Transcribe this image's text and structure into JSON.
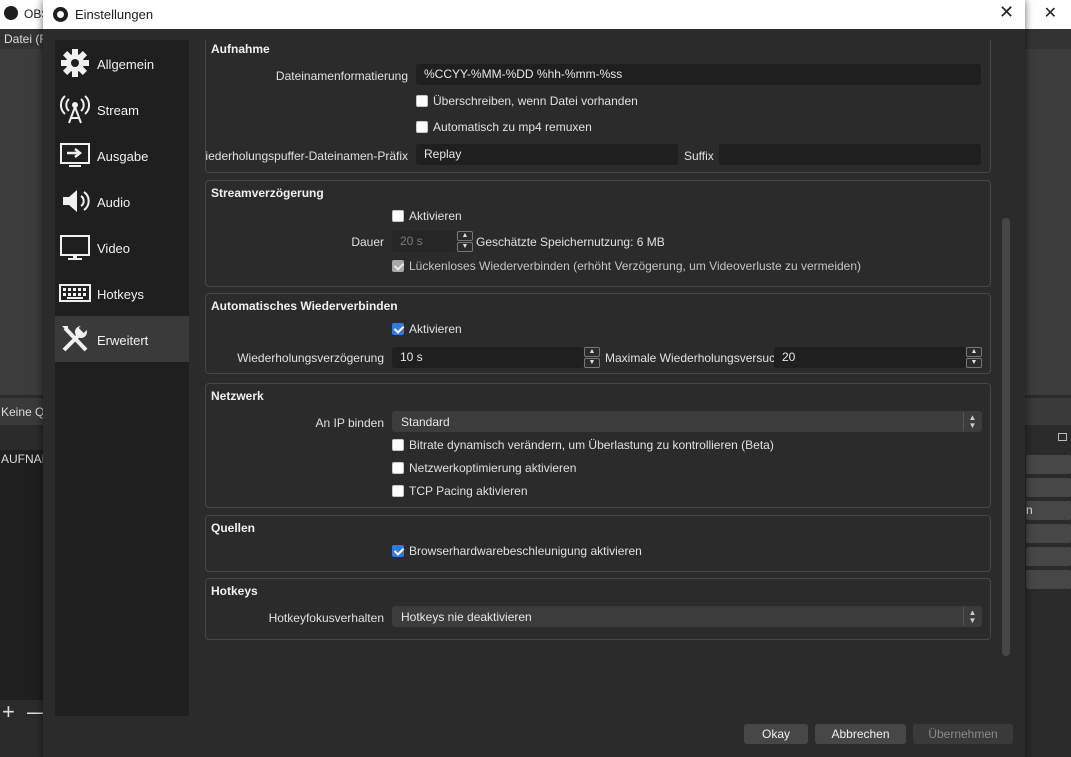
{
  "background": {
    "title": "OBS",
    "menu_label": "Datei (F",
    "dock_label": "Keine Qu",
    "list_item": "AUFNAH",
    "right_text": "n",
    "add_symbol": "+",
    "remove_symbol": "—"
  },
  "dialog": {
    "title": "Einstellungen",
    "close": "✕"
  },
  "sidebar": {
    "items": [
      {
        "label": "Allgemein",
        "icon": "gear-icon"
      },
      {
        "label": "Stream",
        "icon": "broadcast-icon"
      },
      {
        "label": "Ausgabe",
        "icon": "output-icon"
      },
      {
        "label": "Audio",
        "icon": "speaker-icon"
      },
      {
        "label": "Video",
        "icon": "monitor-icon"
      },
      {
        "label": "Hotkeys",
        "icon": "keyboard-icon"
      },
      {
        "label": "Erweitert",
        "icon": "tools-icon"
      }
    ],
    "active_index": 6
  },
  "aufnahme": {
    "title": "Aufnahme",
    "filename_label": "Dateinamenformatierung",
    "filename_value": "%CCYY-%MM-%DD %hh-%mm-%ss",
    "overwrite_label": "Überschreiben, wenn Datei vorhanden",
    "overwrite_checked": false,
    "remux_label": "Automatisch zu mp4 remuxen",
    "remux_checked": false,
    "replay_prefix_label": "Wiederholungspuffer-Dateinamen-Präfix",
    "replay_prefix_value": "Replay",
    "suffix_label": "Suffix",
    "suffix_value": ""
  },
  "streamdelay": {
    "title": "Streamverzögerung",
    "enable_label": "Aktivieren",
    "enable_checked": false,
    "duration_label": "Dauer",
    "duration_value": "20 s",
    "memory_text": "Geschätzte Speichernutzung: 6 MB",
    "preserve_label": "Lückenloses Wiederverbinden (erhöht Verzögerung, um Videoverluste zu vermeiden)",
    "preserve_checked": true
  },
  "reconnect": {
    "title": "Automatisches Wiederverbinden",
    "enable_label": "Aktivieren",
    "enable_checked": true,
    "retry_delay_label": "Wiederholungsverzögerung",
    "retry_delay_value": "10 s",
    "max_retries_label": "Maximale Wiederholungsversuche",
    "max_retries_value": "20"
  },
  "network": {
    "title": "Netzwerk",
    "bind_ip_label": "An IP binden",
    "bind_ip_value": "Standard",
    "dynamic_bitrate_label": "Bitrate dynamisch verändern, um Überlastung zu kontrollieren (Beta)",
    "dynamic_bitrate_checked": false,
    "net_opt_label": "Netzwerkoptimierung aktivieren",
    "net_opt_checked": false,
    "tcp_pacing_label": "TCP Pacing aktivieren",
    "tcp_pacing_checked": false
  },
  "sources": {
    "title": "Quellen",
    "browser_accel_label": "Browserhardwarebeschleunigung aktivieren",
    "browser_accel_checked": true
  },
  "hotkeys": {
    "title": "Hotkeys",
    "focus_label": "Hotkeyfokusverhalten",
    "focus_value": "Hotkeys nie deaktivieren"
  },
  "buttons": {
    "ok": "Okay",
    "cancel": "Abbrechen",
    "apply": "Übernehmen",
    "apply_enabled": false
  },
  "colors": {
    "accent": "#2f79e3",
    "background": "#2b2b2b",
    "sidebar": "#1f1f1f"
  }
}
